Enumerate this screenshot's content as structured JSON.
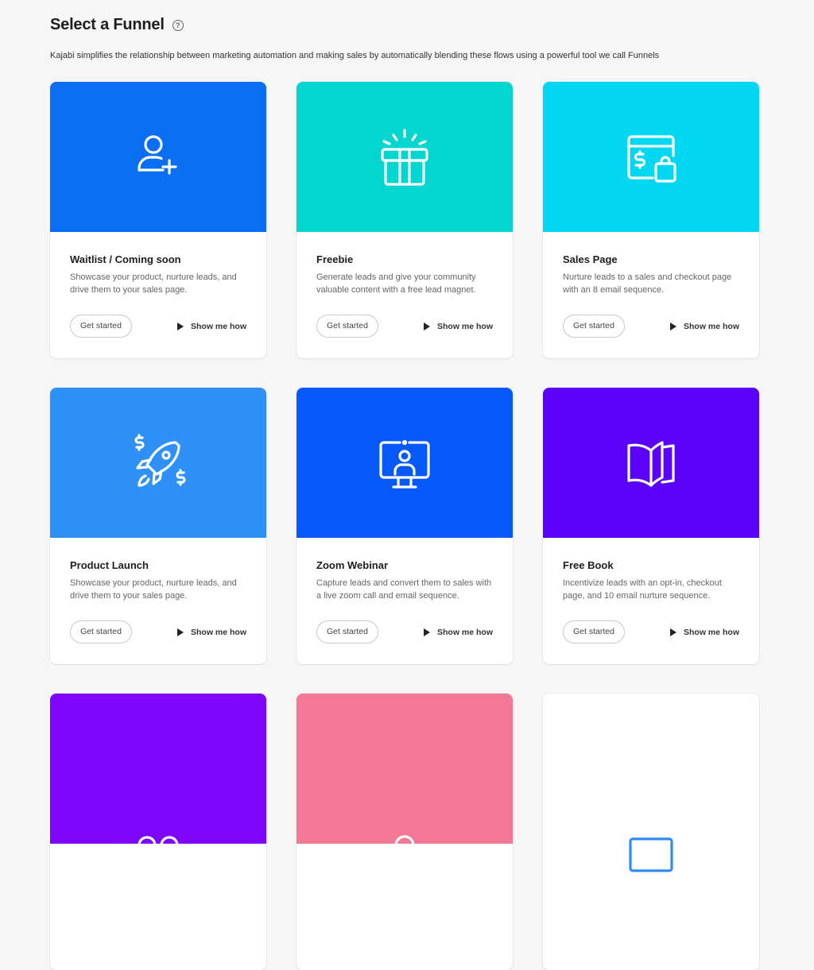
{
  "header": {
    "title": "Select a Funnel",
    "help_icon": "?",
    "subtitle": "Kajabi simplifies the relationship between marketing automation and making sales by automatically blending these flows using a powerful tool we call Funnels"
  },
  "funnels": [
    {
      "title": "Waitlist / Coming soon",
      "description": "Showcase your product, nurture leads, and drive them to your sales page.",
      "color": "#0a6ef2",
      "icon": "user-plus-icon",
      "get_started": "Get started",
      "show_me_how": "Show me how"
    },
    {
      "title": "Freebie",
      "description": "Generate leads and give your community valuable content with a free lead magnet.",
      "color": "#04d6cf",
      "icon": "gift-icon",
      "get_started": "Get started",
      "show_me_how": "Show me how"
    },
    {
      "title": "Sales Page",
      "description": "Nurture leads to a sales and checkout page with an 8 email sequence.",
      "color": "#02d7f2",
      "icon": "sales-page-icon",
      "get_started": "Get started",
      "show_me_how": "Show me how"
    },
    {
      "title": "Product Launch",
      "description": "Showcase your product, nurture leads, and drive them to your sales page.",
      "color": "#2f90f8",
      "icon": "rocket-icon",
      "get_started": "Get started",
      "show_me_how": "Show me how"
    },
    {
      "title": "Zoom Webinar",
      "description": "Capture leads and convert them to sales with a live zoom call and email sequence.",
      "color": "#0659f8",
      "icon": "webinar-icon",
      "get_started": "Get started",
      "show_me_how": "Show me how"
    },
    {
      "title": "Free Book",
      "description": "Incentivize leads with an opt-in, checkout page, and 10 email nurture sequence.",
      "color": "#5a03f8",
      "icon": "book-icon",
      "get_started": "Get started",
      "show_me_how": "Show me how"
    }
  ],
  "partial_cards": [
    {
      "color": "#7e05f8",
      "icon": "users-icon"
    },
    {
      "color": "#f27895",
      "icon": "user-icon"
    },
    {
      "color": "#ffffff",
      "icon": "window-icon"
    }
  ]
}
